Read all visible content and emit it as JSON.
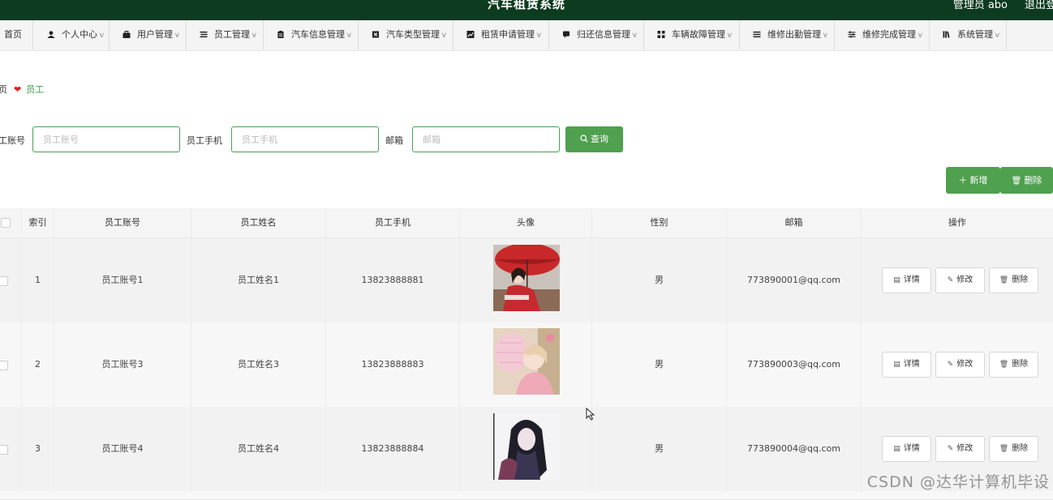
{
  "header": {
    "title": "汽车租赁系统",
    "user": "管理员 abo",
    "logout": "退出登"
  },
  "nav": [
    {
      "label": "首页",
      "icon": "none"
    },
    {
      "label": "个人中心",
      "icon": "user-icon"
    },
    {
      "label": "用户管理",
      "icon": "briefcase-icon"
    },
    {
      "label": "员工管理",
      "icon": "list-icon"
    },
    {
      "label": "汽车信息管理",
      "icon": "clipboard-icon"
    },
    {
      "label": "汽车类型管理",
      "icon": "close-box-icon"
    },
    {
      "label": "租赁申请管理",
      "icon": "chart-icon"
    },
    {
      "label": "归还信息管理",
      "icon": "comment-icon"
    },
    {
      "label": "车辆故障管理",
      "icon": "grid-icon"
    },
    {
      "label": "维修出勤管理",
      "icon": "menu-icon"
    },
    {
      "label": "维修完成管理",
      "icon": "sliders-icon"
    },
    {
      "label": "系统管理",
      "icon": "book-icon"
    }
  ],
  "breadcrumb": {
    "home": "页",
    "current": "员工"
  },
  "filters": {
    "account_label": "工账号",
    "account_placeholder": "员工账号",
    "phone_label": "员工手机",
    "phone_placeholder": "员工手机",
    "email_label": "邮箱",
    "email_placeholder": "邮箱",
    "search_label": "查询"
  },
  "actions": {
    "add_label": "新增",
    "delete_label": "删除"
  },
  "table": {
    "headers": [
      "索引",
      "员工账号",
      "员工姓名",
      "员工手机",
      "头像",
      "性别",
      "邮箱",
      "操作"
    ],
    "rows": [
      {
        "index": "1",
        "account": "员工账号1",
        "name": "员工姓名1",
        "phone": "13823888881",
        "gender": "男",
        "email": "773890001@qq.com"
      },
      {
        "index": "2",
        "account": "员工账号3",
        "name": "员工姓名3",
        "phone": "13823888883",
        "gender": "男",
        "email": "773890003@qq.com"
      },
      {
        "index": "3",
        "account": "员工账号4",
        "name": "员工姓名4",
        "phone": "13823888884",
        "gender": "男",
        "email": "773890004@qq.com"
      }
    ],
    "op_labels": {
      "detail": "详情",
      "edit": "修改",
      "delete": "删除"
    }
  },
  "watermark": "CSDN @达华计算机毕设",
  "colors": {
    "header_bg": "#0d3b1f",
    "accent": "#4fa04f",
    "heart": "#e0201c"
  }
}
